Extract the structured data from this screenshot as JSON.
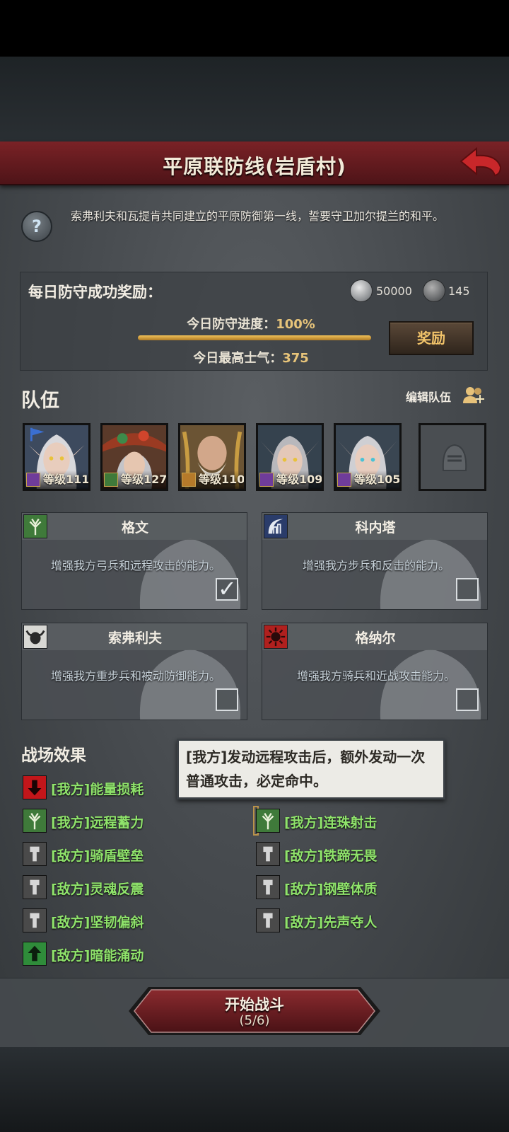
{
  "header": {
    "title": "平原联防线(岩盾村)"
  },
  "description": "索弗利夫和瓦提肯共同建立的平原防御第一线，誓要守卫加尔提兰的和平。",
  "reward": {
    "title": "每日防守成功奖励：",
    "silver": "50000",
    "dark_coin": "145",
    "progress_label": "今日防守进度：",
    "progress_value": "100%",
    "progress_fraction": 1.0,
    "morale_label": "今日最高士气：",
    "morale_value": "375",
    "button": "奖励"
  },
  "team": {
    "title": "队伍",
    "edit_label": "编辑队伍",
    "heroes": [
      {
        "level": "等级111"
      },
      {
        "level": "等级127"
      },
      {
        "level": "等级110"
      },
      {
        "level": "等级109"
      },
      {
        "level": "等级105"
      }
    ]
  },
  "alliances": [
    {
      "name": "格文",
      "desc": "增强我方弓兵和远程攻击的能力。",
      "checked": true
    },
    {
      "name": "科内塔",
      "desc": "增强我方步兵和反击的能力。",
      "checked": false
    },
    {
      "name": "索弗利夫",
      "desc": "增强我方重步兵和被动防御能力。",
      "checked": false
    },
    {
      "name": "格纳尔",
      "desc": "增强我方骑兵和近战攻击能力。",
      "checked": false
    }
  ],
  "battlefield": {
    "title": "战场效果",
    "effects_left": [
      "[我方]能量损耗",
      "[我方]远程蓄力",
      "[敌方]骑盾壁垒",
      "[敌方]灵魂反震",
      "[敌方]坚韧偏斜",
      "[敌方]暗能涌动"
    ],
    "effects_right": [
      "[我方]连珠射击",
      "[敌方]铁蹄无畏",
      "[敌方]钢壁体质",
      "[敌方]先声夺人"
    ],
    "tooltip": "[我方]发动远程攻击后，额外发动一次普通攻击，必定命中。"
  },
  "start": {
    "label": "开始战斗",
    "count": "(5/6)"
  },
  "colors": {
    "accent_red": "#7a2226",
    "effect_green": "#8fe36b",
    "gold": "#e7c47a"
  }
}
